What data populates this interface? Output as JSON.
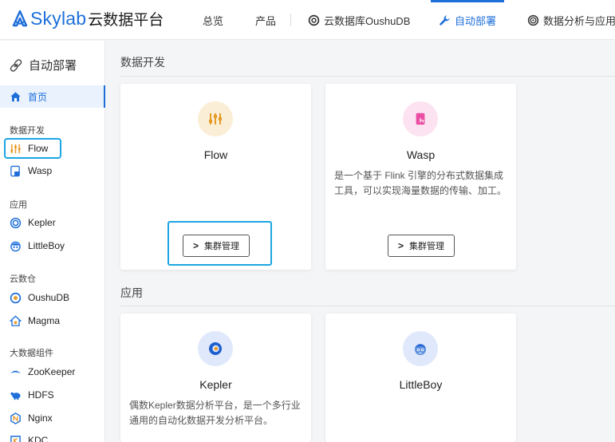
{
  "header": {
    "logo_en": "Skylab",
    "logo_cn": "云数据平台",
    "nav": [
      {
        "label": "总览"
      },
      {
        "label": "产品"
      },
      {
        "label": "云数据库OushuDB",
        "icon": "oushudb-icon"
      },
      {
        "label": "自动部署",
        "icon": "wrench-icon",
        "active": true
      },
      {
        "label": "数据分析与应用Ke",
        "icon": "kepler-icon"
      }
    ]
  },
  "sidebar": {
    "title": "自动部署",
    "home": "首页",
    "groups": [
      {
        "label": "数据开发",
        "items": [
          "Flow",
          "Wasp"
        ]
      },
      {
        "label": "应用",
        "items": [
          "Kepler",
          "LittleBoy"
        ]
      },
      {
        "label": "云数仓",
        "items": [
          "OushuDB",
          "Magma"
        ]
      },
      {
        "label": "大数据组件",
        "items": [
          "ZooKeeper",
          "HDFS",
          "Nginx",
          "KDC"
        ]
      }
    ]
  },
  "main": {
    "sections": [
      {
        "title": "数据开发",
        "cards": [
          {
            "name": "Flow",
            "desc": "",
            "button": "集群管理"
          },
          {
            "name": "Wasp",
            "desc": "是一个基于 Flink 引擎的分布式数据集成工具，可以实现海量数据的传输、加工。",
            "button": "集群管理"
          }
        ]
      },
      {
        "title": "应用",
        "cards": [
          {
            "name": "Kepler",
            "desc": "偶数Kepler数据分析平台，是一个多行业通用的自动化数据开发分析平台。"
          },
          {
            "name": "LittleBoy",
            "desc": ""
          }
        ]
      }
    ]
  },
  "colors": {
    "accent": "#1e6fd9",
    "highlight": "#1ba6e4"
  }
}
